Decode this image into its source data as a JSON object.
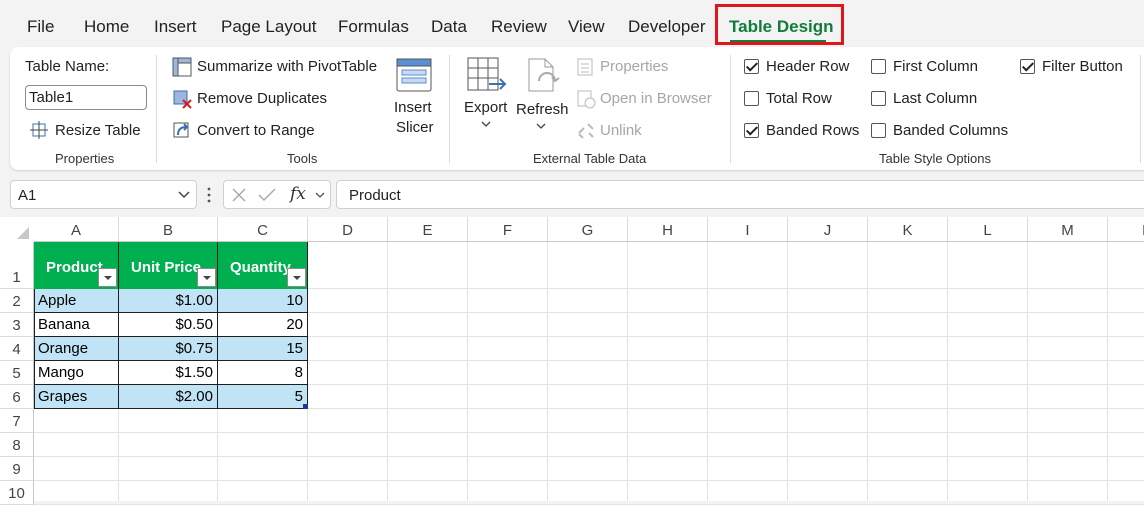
{
  "tabs": [
    {
      "label": "File",
      "active": false
    },
    {
      "label": "Home",
      "active": false
    },
    {
      "label": "Insert",
      "active": false
    },
    {
      "label": "Page Layout",
      "active": false
    },
    {
      "label": "Formulas",
      "active": false
    },
    {
      "label": "Data",
      "active": false
    },
    {
      "label": "Review",
      "active": false
    },
    {
      "label": "View",
      "active": false
    },
    {
      "label": "Developer",
      "active": false
    },
    {
      "label": "Table Design",
      "active": true
    }
  ],
  "ribbon": {
    "properties": {
      "table_name_label": "Table Name:",
      "table_name_value": "Table1",
      "resize_label": "Resize Table",
      "group_label": "Properties"
    },
    "tools": {
      "pivot_label": "Summarize with PivotTable",
      "dupes_label": "Remove Duplicates",
      "convert_label": "Convert to Range",
      "slicer_label_1": "Insert",
      "slicer_label_2": "Slicer",
      "group_label": "Tools"
    },
    "external": {
      "export_label": "Export",
      "refresh_label": "Refresh",
      "properties_label": "Properties",
      "open_browser_label": "Open in Browser",
      "unlink_label": "Unlink",
      "group_label": "External Table Data"
    },
    "style_options": {
      "header_row": {
        "label": "Header Row",
        "checked": true
      },
      "total_row": {
        "label": "Total Row",
        "checked": false
      },
      "banded_rows": {
        "label": "Banded Rows",
        "checked": true
      },
      "first_column": {
        "label": "First Column",
        "checked": false
      },
      "last_column": {
        "label": "Last Column",
        "checked": false
      },
      "banded_columns": {
        "label": "Banded Columns",
        "checked": false
      },
      "filter_button": {
        "label": "Filter Button",
        "checked": true
      },
      "group_label": "Table Style Options"
    }
  },
  "formula_bar": {
    "cell_ref": "A1",
    "fx_label": "fx",
    "content": "Product"
  },
  "columns": [
    "A",
    "B",
    "C",
    "D",
    "E",
    "F",
    "G",
    "H",
    "I",
    "J",
    "K",
    "L",
    "M",
    "N"
  ],
  "rows": [
    "1",
    "2",
    "3",
    "4",
    "5",
    "6",
    "7",
    "8",
    "9",
    "10"
  ],
  "table": {
    "headers": [
      "Product",
      "Unit Price",
      "Quantity"
    ],
    "rows": [
      [
        "Apple",
        "$1.00",
        "10"
      ],
      [
        "Banana",
        "$0.50",
        "20"
      ],
      [
        "Orange",
        "$0.75",
        "15"
      ],
      [
        "Mango",
        "$1.50",
        "8"
      ],
      [
        "Grapes",
        "$2.00",
        "5"
      ]
    ],
    "header_color": "#00b050",
    "band_color": "#c0e4f5"
  },
  "colors": {
    "accent": "#127c3b",
    "highlight_box": "#e0161f"
  }
}
